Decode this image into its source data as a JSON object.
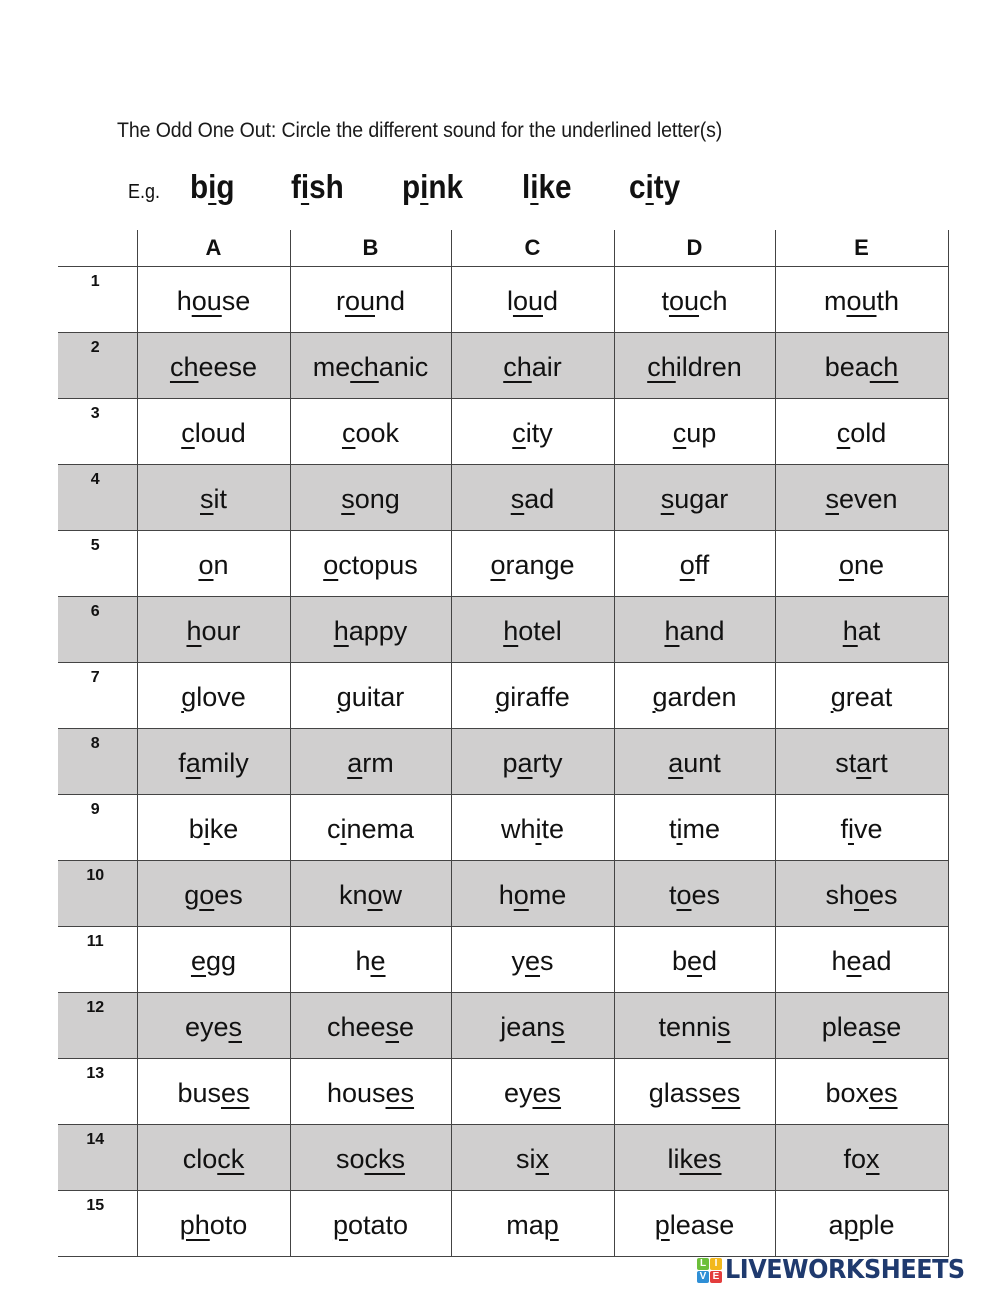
{
  "instruction": "The Odd One Out: Circle the different sound for the underlined letter(s)",
  "example": {
    "label": "E.g.",
    "words": [
      {
        "pre": "b",
        "u": "i",
        "post": "g"
      },
      {
        "pre": "f",
        "u": "i",
        "post": "sh"
      },
      {
        "pre": "p",
        "u": "i",
        "post": "nk"
      },
      {
        "pre": "l",
        "u": "i",
        "post": "ke"
      },
      {
        "pre": "c",
        "u": "i",
        "post": "ty"
      }
    ]
  },
  "table": {
    "columns": [
      "A",
      "B",
      "C",
      "D",
      "E"
    ],
    "rows": [
      {
        "num": "1",
        "words": [
          {
            "pre": "h",
            "u": "ou",
            "post": "se"
          },
          {
            "pre": "r",
            "u": "ou",
            "post": "nd"
          },
          {
            "pre": "l",
            "u": "ou",
            "post": "d"
          },
          {
            "pre": "t",
            "u": "ou",
            "post": "ch"
          },
          {
            "pre": "m",
            "u": "ou",
            "post": "th"
          }
        ]
      },
      {
        "num": "2",
        "words": [
          {
            "pre": "",
            "u": "ch",
            "post": "eese"
          },
          {
            "pre": "me",
            "u": "ch",
            "post": "anic"
          },
          {
            "pre": "",
            "u": "ch",
            "post": "air"
          },
          {
            "pre": "",
            "u": "ch",
            "post": "ildren"
          },
          {
            "pre": "bea",
            "u": "ch",
            "post": ""
          }
        ]
      },
      {
        "num": "3",
        "words": [
          {
            "pre": "",
            "u": "c",
            "post": "loud"
          },
          {
            "pre": "",
            "u": "c",
            "post": "ook"
          },
          {
            "pre": "",
            "u": "c",
            "post": "ity"
          },
          {
            "pre": "",
            "u": "c",
            "post": "up"
          },
          {
            "pre": "",
            "u": "c",
            "post": "old"
          }
        ]
      },
      {
        "num": "4",
        "words": [
          {
            "pre": "",
            "u": "s",
            "post": "it"
          },
          {
            "pre": "",
            "u": "s",
            "post": "ong"
          },
          {
            "pre": "",
            "u": "s",
            "post": "ad"
          },
          {
            "pre": "",
            "u": "s",
            "post": "ugar"
          },
          {
            "pre": "",
            "u": "s",
            "post": "even"
          }
        ]
      },
      {
        "num": "5",
        "words": [
          {
            "pre": "",
            "u": "o",
            "post": "n"
          },
          {
            "pre": "",
            "u": "o",
            "post": "ctopus"
          },
          {
            "pre": "",
            "u": "o",
            "post": "range"
          },
          {
            "pre": "",
            "u": "o",
            "post": "ff"
          },
          {
            "pre": "",
            "u": "o",
            "post": "ne"
          }
        ]
      },
      {
        "num": "6",
        "words": [
          {
            "pre": "",
            "u": "h",
            "post": "our"
          },
          {
            "pre": "",
            "u": "h",
            "post": "appy"
          },
          {
            "pre": "",
            "u": "h",
            "post": "otel"
          },
          {
            "pre": "",
            "u": "h",
            "post": "and"
          },
          {
            "pre": "",
            "u": "h",
            "post": "at"
          }
        ]
      },
      {
        "num": "7",
        "words": [
          {
            "pre": "",
            "u": "g",
            "post": "love"
          },
          {
            "pre": "",
            "u": "g",
            "post": "uitar"
          },
          {
            "pre": "",
            "u": "g",
            "post": "iraffe"
          },
          {
            "pre": "",
            "u": "g",
            "post": "arden"
          },
          {
            "pre": "",
            "u": "g",
            "post": "reat"
          }
        ]
      },
      {
        "num": "8",
        "words": [
          {
            "pre": "f",
            "u": "a",
            "post": "mily"
          },
          {
            "pre": "",
            "u": "a",
            "post": "rm"
          },
          {
            "pre": "p",
            "u": "a",
            "post": "rty"
          },
          {
            "pre": "",
            "u": "a",
            "post": "unt"
          },
          {
            "pre": "st",
            "u": "a",
            "post": "rt"
          }
        ]
      },
      {
        "num": "9",
        "words": [
          {
            "pre": "b",
            "u": "i",
            "post": "ke"
          },
          {
            "pre": "c",
            "u": "i",
            "post": "nema"
          },
          {
            "pre": "wh",
            "u": "i",
            "post": "te"
          },
          {
            "pre": "t",
            "u": "i",
            "post": "me"
          },
          {
            "pre": "f",
            "u": "i",
            "post": "ve"
          }
        ]
      },
      {
        "num": "10",
        "words": [
          {
            "pre": "g",
            "u": "o",
            "post": "es"
          },
          {
            "pre": "kn",
            "u": "o",
            "post": "w"
          },
          {
            "pre": "h",
            "u": "o",
            "post": "me"
          },
          {
            "pre": "t",
            "u": "o",
            "post": "es"
          },
          {
            "pre": "sh",
            "u": "o",
            "post": "es"
          }
        ]
      },
      {
        "num": "11",
        "words": [
          {
            "pre": "",
            "u": "e",
            "post": "gg"
          },
          {
            "pre": "h",
            "u": "e",
            "post": ""
          },
          {
            "pre": "y",
            "u": "e",
            "post": "s"
          },
          {
            "pre": "b",
            "u": "e",
            "post": "d"
          },
          {
            "pre": "h",
            "u": "e",
            "post": "ad"
          }
        ]
      },
      {
        "num": "12",
        "words": [
          {
            "pre": "eye",
            "u": "s",
            "post": ""
          },
          {
            "pre": "chee",
            "u": "s",
            "post": "e"
          },
          {
            "pre": "jean",
            "u": "s",
            "post": ""
          },
          {
            "pre": "tenni",
            "u": "s",
            "post": ""
          },
          {
            "pre": "plea",
            "u": "s",
            "post": "e"
          }
        ]
      },
      {
        "num": "13",
        "words": [
          {
            "pre": "bus",
            "u": "es",
            "post": ""
          },
          {
            "pre": "hous",
            "u": "es",
            "post": ""
          },
          {
            "pre": "ey",
            "u": "es",
            "post": ""
          },
          {
            "pre": "glass",
            "u": "es",
            "post": ""
          },
          {
            "pre": "box",
            "u": "es",
            "post": ""
          }
        ]
      },
      {
        "num": "14",
        "words": [
          {
            "pre": "clo",
            "u": "ck",
            "post": ""
          },
          {
            "pre": "so",
            "u": "cks",
            "post": ""
          },
          {
            "pre": "si",
            "u": "x",
            "post": ""
          },
          {
            "pre": "li",
            "u": "kes",
            "post": ""
          },
          {
            "pre": "fo",
            "u": "x",
            "post": ""
          }
        ]
      },
      {
        "num": "15",
        "words": [
          {
            "pre": "",
            "u": "ph",
            "post": "oto"
          },
          {
            "pre": "",
            "u": "p",
            "post": "otato"
          },
          {
            "pre": "ma",
            "u": "p",
            "post": ""
          },
          {
            "pre": "",
            "u": "p",
            "post": "lease"
          },
          {
            "pre": "a",
            "u": "p",
            "post": "ple"
          }
        ]
      }
    ]
  },
  "logo": {
    "tiles": [
      {
        "letter": "L",
        "color": "#6cbf3a"
      },
      {
        "letter": "I",
        "color": "#f2b81c"
      },
      {
        "letter": "V",
        "color": "#2f8fd6"
      },
      {
        "letter": "E",
        "color": "#e33d3d"
      }
    ],
    "text": "LIVEWORKSHEETS",
    "color": "#1f3a6e"
  },
  "colors": {
    "shaded_row": "#d0cfcf",
    "border": "#444444"
  }
}
